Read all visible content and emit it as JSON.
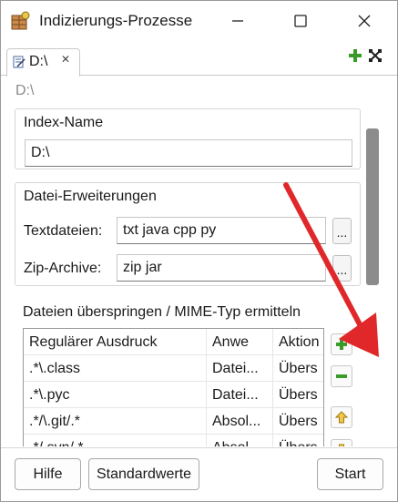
{
  "window": {
    "title": "Indizierungs-Prozesse",
    "controls": [
      "minimize-icon",
      "maximize-icon",
      "close-icon"
    ]
  },
  "tab": {
    "label": "D:\\",
    "close_glyph": "✕"
  },
  "toolbar": {
    "icons": [
      "add-icon",
      "cross-icon"
    ]
  },
  "breadcrumb": "D:\\",
  "index_name": {
    "title": "Index-Name",
    "value": "D:\\"
  },
  "extensions": {
    "title": "Datei-Erweiterungen",
    "text_label": "Textdateien:",
    "text_value": "txt java cpp py",
    "zip_label": "Zip-Archive:",
    "zip_value": "zip jar",
    "browse_label": "..."
  },
  "skip": {
    "title": "Dateien überspringen / MIME-Typ ermitteln",
    "columns": [
      "Regulärer Ausdruck",
      "Anwe",
      "Aktion"
    ],
    "rows": [
      [
        ".*\\.class",
        "Datei...",
        "Übers"
      ],
      [
        ".*\\.pyc",
        "Datei...",
        "Übers"
      ],
      [
        ".*/\\.git/.*",
        "Absol...",
        "Übers"
      ],
      [
        ".*/.svn/.*",
        "Absol...",
        "Übers"
      ]
    ],
    "side_buttons": [
      "add-row-icon",
      "remove-row-icon",
      "move-up-icon",
      "move-down-icon"
    ]
  },
  "buttons": {
    "help": "Hilfe",
    "defaults": "Standardwerte",
    "start": "Start"
  },
  "colors": {
    "accent_green": "#3a9a2a",
    "arrow_red": "#e0282a",
    "scroll_thumb": "#8c8c8c",
    "muted_text": "#8a8a8a"
  }
}
